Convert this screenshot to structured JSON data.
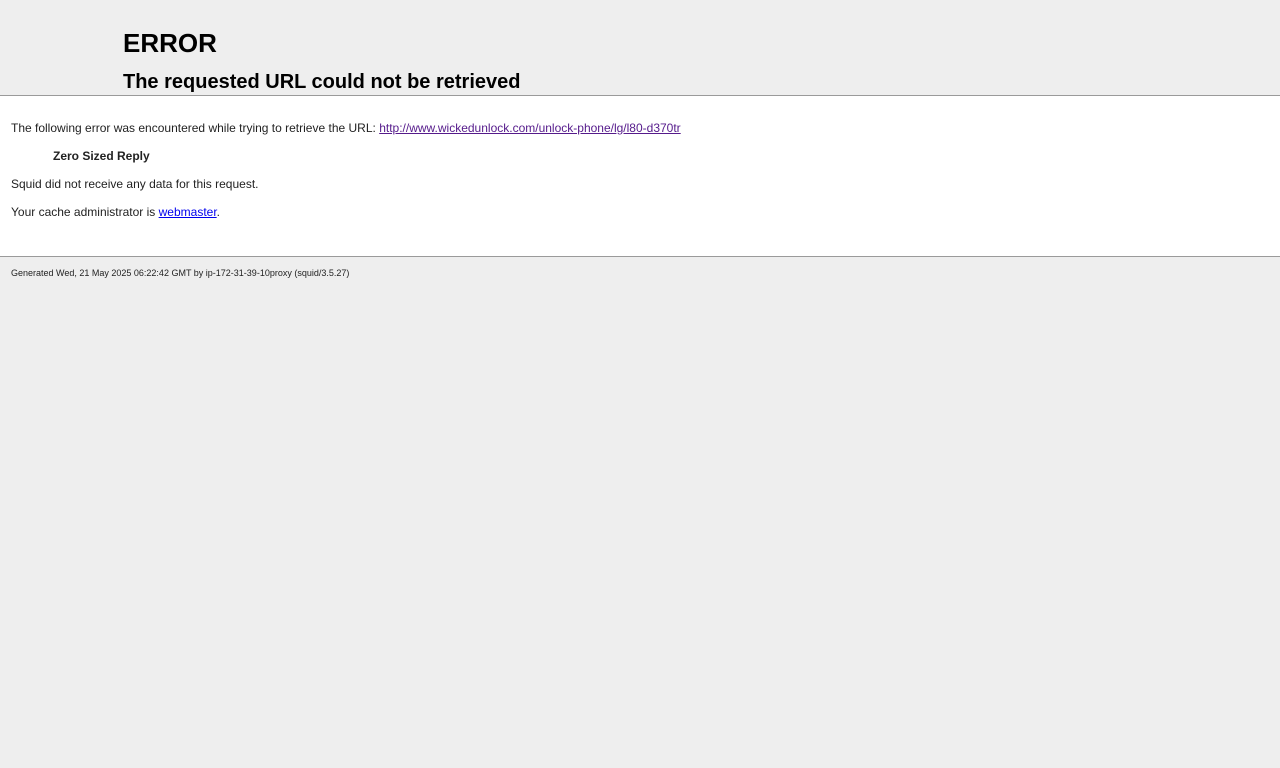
{
  "header": {
    "title": "ERROR",
    "subtitle": "The requested URL could not be retrieved"
  },
  "content": {
    "intro_text": "The following error was encountered while trying to retrieve the URL: ",
    "url": "http://www.wickedunlock.com/unlock-phone/lg/l80-d370tr",
    "error_reason": "Zero Sized Reply",
    "description": "Squid did not receive any data for this request.",
    "admin_prefix": "Your cache administrator is ",
    "admin_link": "webmaster",
    "admin_suffix": "."
  },
  "footer": {
    "generated": "Generated Wed, 21 May 2025 06:22:42 GMT by ip-172-31-39-10proxy (squid/3.5.27)"
  }
}
